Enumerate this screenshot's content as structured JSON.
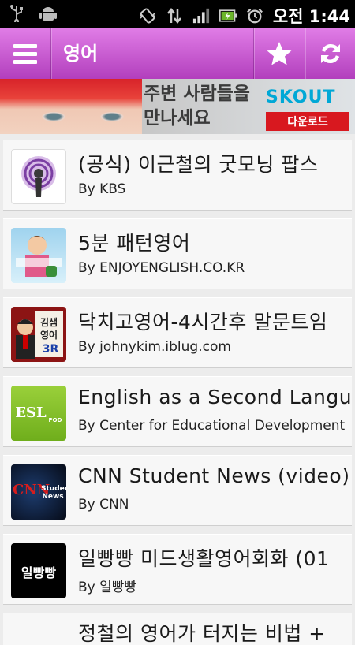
{
  "status_bar": {
    "time": "오전 1:44",
    "icons": [
      "usb-icon",
      "android-debug-icon",
      "vibrate-icon",
      "data-transfer-icon",
      "signal-icon",
      "battery-icon",
      "alarm-icon"
    ]
  },
  "action_bar": {
    "title": "영어",
    "color": "#b23fbd"
  },
  "banner": {
    "text": "주변 사람들을 만나세요",
    "logo": "SKOUT",
    "download_label": "다운로드"
  },
  "podcasts": [
    {
      "title": "(공식) 이근철의 굿모닝 팝스",
      "author": "By KBS",
      "thumb": "podcast-icon"
    },
    {
      "title": "5분 패턴영어",
      "author": "By ENJOYENGLISH.CO.KR",
      "thumb": "cartoon-teacher"
    },
    {
      "title": "닥치고영어-4시간후 말문트임",
      "author": "By johnykim.iblug.com",
      "thumb_text": "김샘 영어",
      "thumb_badge": "3R"
    },
    {
      "title": "English as a Second Language",
      "author": "By Center for Educational Development",
      "thumb_text": "ESL",
      "thumb_badge": "POD"
    },
    {
      "title": "CNN Student News (video)",
      "author": "By CNN",
      "thumb_text": "CNN",
      "thumb_badge": "Student News"
    },
    {
      "title": "일빵빵 미드생활영어회화 (01",
      "author": "By 일빵빵",
      "thumb_text": "일빵빵"
    },
    {
      "title": "정철의 영어가 터지는 비법 +",
      "author": "",
      "thumb": "partial"
    }
  ]
}
